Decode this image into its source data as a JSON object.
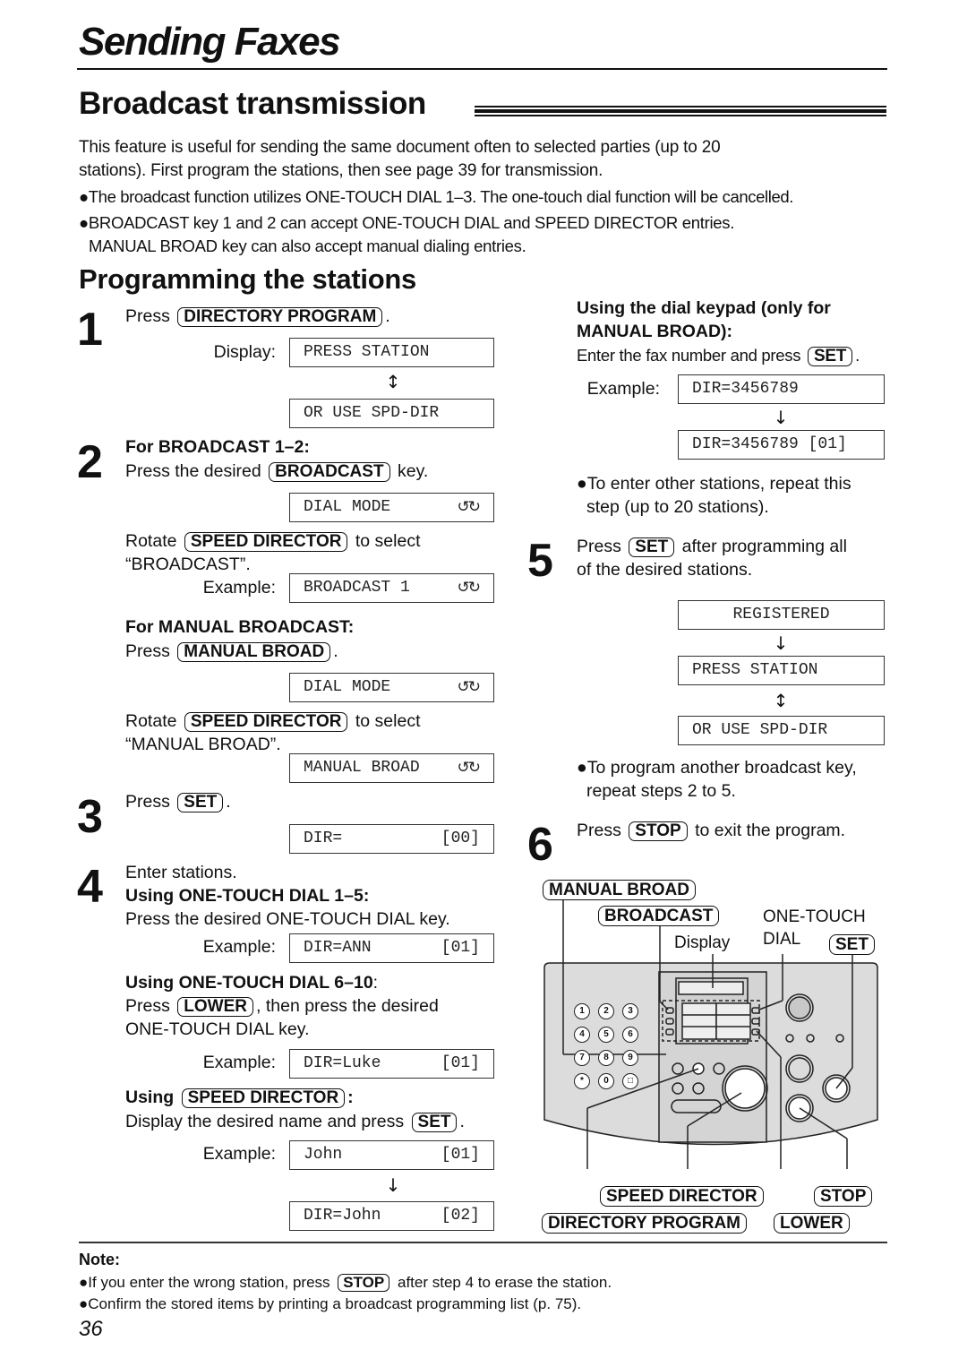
{
  "chapter_title": "Sending Faxes",
  "section_title": "Broadcast transmission",
  "intro": {
    "line1": "This feature is useful for sending the same document often to selected parties (up to 20",
    "line2": "stations). First program the stations, then see page 39 for transmission.",
    "bullet1": "●The broadcast function utilizes ONE-TOUCH DIAL 1–3. The one-touch dial function will be cancelled.",
    "bullet2a": "●BROADCAST key 1 and 2 can accept ONE-TOUCH DIAL and SPEED DIRECTOR entries.",
    "bullet2b": "MANUAL BROAD key can also accept manual dialing entries."
  },
  "subsection_title": "Programming the stations",
  "keys": {
    "directory_program": "DIRECTORY PROGRAM",
    "broadcast": "BROADCAST",
    "speed_director": "SPEED DIRECTOR",
    "manual_broad": "MANUAL BROAD",
    "set": "SET",
    "lower": "LOWER",
    "stop": "STOP"
  },
  "icons": {
    "rotate": "↺↻",
    "updown": "↕",
    "down": "↓"
  },
  "labels": {
    "display": "Display:",
    "example": "Example:",
    "press": "Press",
    "rotate": "Rotate",
    "to_select": "to select",
    "period": ".",
    "key": "key.",
    "comma_then": ", then press the desired",
    "colon": ":"
  },
  "steps": {
    "s1": {
      "num": "1"
    },
    "s2": {
      "num": "2",
      "heading": "For BROADCAST 1–2:",
      "press_the_desired": "Press the desired",
      "select_value": "“BROADCAST”.",
      "manual_heading": "For MANUAL BROADCAST:",
      "manual_select_value": "“MANUAL BROAD”."
    },
    "s3": {
      "num": "3"
    },
    "s4": {
      "num": "4",
      "enter": "Enter stations.",
      "otd15_heading": "Using ONE-TOUCH DIAL 1–5:",
      "otd15_text": "Press the desired ONE-TOUCH DIAL key.",
      "otd610_heading": "Using ONE-TOUCH DIAL 6–10",
      "otd610_text2": "ONE-TOUCH DIAL key.",
      "using": "Using",
      "sd_text": "Display the desired name and press",
      "keypad_heading1": "Using the dial keypad (only for",
      "keypad_heading2": "MANUAL BROAD):",
      "keypad_text": "Enter the fax number and press",
      "repeat1": "●To enter other stations, repeat this",
      "repeat2": "step (up to 20 stations)."
    },
    "s5": {
      "num": "5",
      "after": "after programming all",
      "after2": "of the desired stations.",
      "another1": "●To program another broadcast key,",
      "another2": "repeat steps 2 to 5."
    },
    "s6": {
      "num": "6",
      "text": "to exit the program."
    }
  },
  "lcd": {
    "press_station": "PRESS STATION",
    "or_use_spd_dir": "OR USE SPD-DIR",
    "dial_mode": "DIAL MODE",
    "broadcast_1": "BROADCAST 1",
    "manual_broad": "MANUAL BROAD",
    "dir_empty": "DIR=",
    "dir_empty_idx": "[00]",
    "dir_ann": "DIR=ANN",
    "dir_ann_idx": "[01]",
    "dir_luke": "DIR=Luke",
    "dir_luke_idx": "[01]",
    "john": "John",
    "john_idx": "[01]",
    "dir_john": "DIR=John",
    "dir_john_idx": "[02]",
    "dir_num": "DIR=3456789",
    "dir_num_idx": "DIR=3456789 [01]",
    "registered": "REGISTERED"
  },
  "diagram": {
    "manual_broad": "MANUAL BROAD",
    "broadcast": "BROADCAST",
    "display": "Display",
    "one_touch": "ONE-TOUCH",
    "dial": "DIAL",
    "set": "SET",
    "speed_director": "SPEED DIRECTOR",
    "stop": "STOP",
    "directory_program": "DIRECTORY PROGRAM",
    "lower": "LOWER",
    "keypad": [
      "1",
      "2",
      "3",
      "4",
      "5",
      "6",
      "7",
      "8",
      "9",
      "*",
      "0",
      "□"
    ]
  },
  "note": {
    "heading": "Note:",
    "line1a": "●If you enter the wrong station, press",
    "line1b": "after step 4 to erase the station.",
    "line2": "●Confirm the stored items by printing a broadcast programming list (p. 75)."
  },
  "page_number": "36"
}
